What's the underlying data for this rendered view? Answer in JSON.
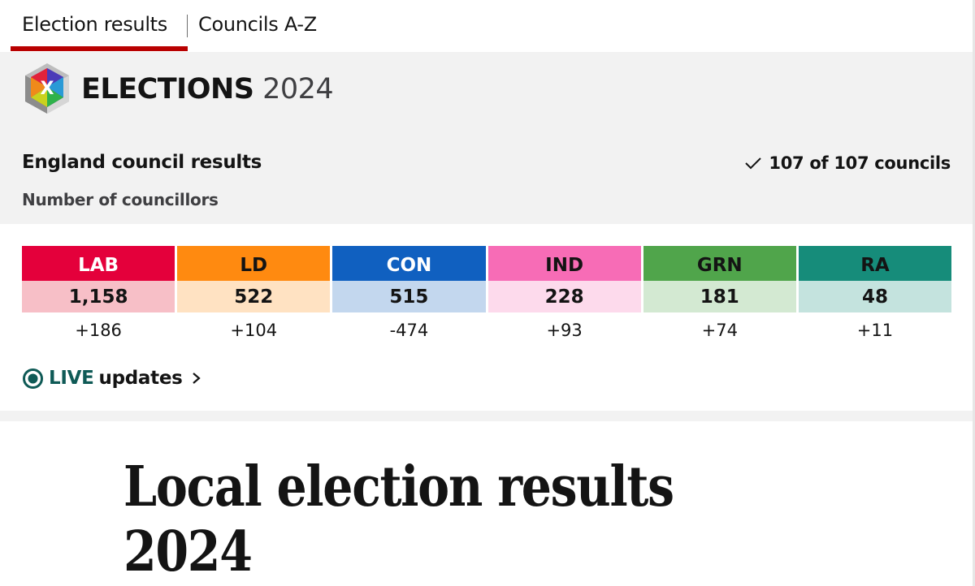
{
  "nav": {
    "items": [
      {
        "label": "Election results",
        "active": true
      },
      {
        "label": "Councils A-Z",
        "active": false
      }
    ],
    "active_color": "#b80000"
  },
  "header": {
    "logo_icon": "ballot-cross-cube-icon",
    "logo_letter": "X",
    "brand_bold": "ELECTIONS",
    "brand_year": "2024"
  },
  "results": {
    "title": "England council results",
    "subtitle": "Number of councillors",
    "progress_icon": "check-icon",
    "progress_text": "107 of 107 councils",
    "councils_declared": 107,
    "councils_total": 107
  },
  "parties": [
    {
      "abbr": "LAB",
      "count": "1,158",
      "change": "+186",
      "color": "#e4003b",
      "tint": "#f7bfc7",
      "text_color": "#ffffff"
    },
    {
      "abbr": "LD",
      "count": "522",
      "change": "+104",
      "color": "#ff8a10",
      "tint": "#ffe2c2",
      "text_color": "#141414"
    },
    {
      "abbr": "CON",
      "count": "515",
      "change": "-474",
      "color": "#1060c0",
      "tint": "#c3d7ee",
      "text_color": "#ffffff"
    },
    {
      "abbr": "IND",
      "count": "228",
      "change": "+93",
      "color": "#f76cb6",
      "tint": "#fddaec",
      "text_color": "#141414"
    },
    {
      "abbr": "GRN",
      "count": "181",
      "change": "+74",
      "color": "#50a54b",
      "tint": "#d3e9d2",
      "text_color": "#141414"
    },
    {
      "abbr": "RA",
      "count": "48",
      "change": "+11",
      "color": "#168c7a",
      "tint": "#c4e3de",
      "text_color": "#141414"
    }
  ],
  "live": {
    "icon": "live-radio-icon",
    "word": "LIVE",
    "rest": "updates",
    "chevron": "chevron-right-icon",
    "color": "#0f5a56"
  },
  "headline": {
    "line1": "Local election results",
    "line2": "2024"
  }
}
